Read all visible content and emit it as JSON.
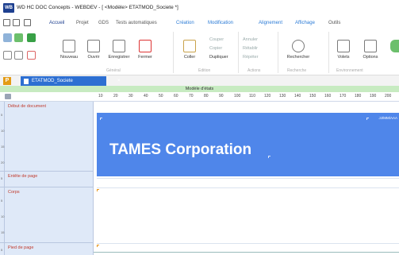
{
  "window": {
    "title": "WD HC DOC Concepts - WEBDEV - [ <Modèle> ETATMOD_Societe *]",
    "logo_text": "WB"
  },
  "ribbon_tabs": [
    {
      "label": "Accueil"
    },
    {
      "label": "Projet"
    },
    {
      "label": "GDS"
    },
    {
      "label": "Tests automatiques"
    },
    {
      "label": "Création"
    },
    {
      "label": "Modification"
    },
    {
      "label": "Alignement"
    },
    {
      "label": "Affichage"
    },
    {
      "label": "Outils"
    }
  ],
  "ribbon": {
    "nouveau": "Nouveau",
    "ouvrir": "Ouvrir",
    "enregistrer": "Enregistrer",
    "fermer": "Fermer",
    "coller": "Coller",
    "couper": "Couper",
    "copier": "Copier",
    "dupliquer": "Dupliquer",
    "annuler": "Annuler",
    "retablir": "Rétablir",
    "repeter": "Répéter",
    "rechercher": "Rechercher",
    "volets": "Volets",
    "options": "Options",
    "groups": {
      "general": "Général",
      "edition": "Edition",
      "actions": "Actions",
      "recherche": "Recherche",
      "environnement": "Environnement"
    }
  },
  "document": {
    "tab_label": "ETATMOD_Societe",
    "close": "×",
    "header_title": "Modèle d'états"
  },
  "ruler": {
    "labels": [
      "10",
      "20",
      "30",
      "40",
      "50",
      "60",
      "70",
      "80",
      "90",
      "100",
      "110",
      "120",
      "130",
      "140",
      "150",
      "160",
      "170",
      "180",
      "190",
      "200"
    ]
  },
  "sections": [
    {
      "label": "Début de document"
    },
    {
      "label": "Entête de page"
    },
    {
      "label": "Corps"
    },
    {
      "label": "Pied de page"
    }
  ],
  "canvas": {
    "company": "TAMES Corporation",
    "date": "JJ/MM/AAA"
  },
  "colors": {
    "accent": "#2d6fd2",
    "banner": "#4f86ea",
    "header_green": "#c7ebc1",
    "section_panel": "#dfe9f8"
  }
}
